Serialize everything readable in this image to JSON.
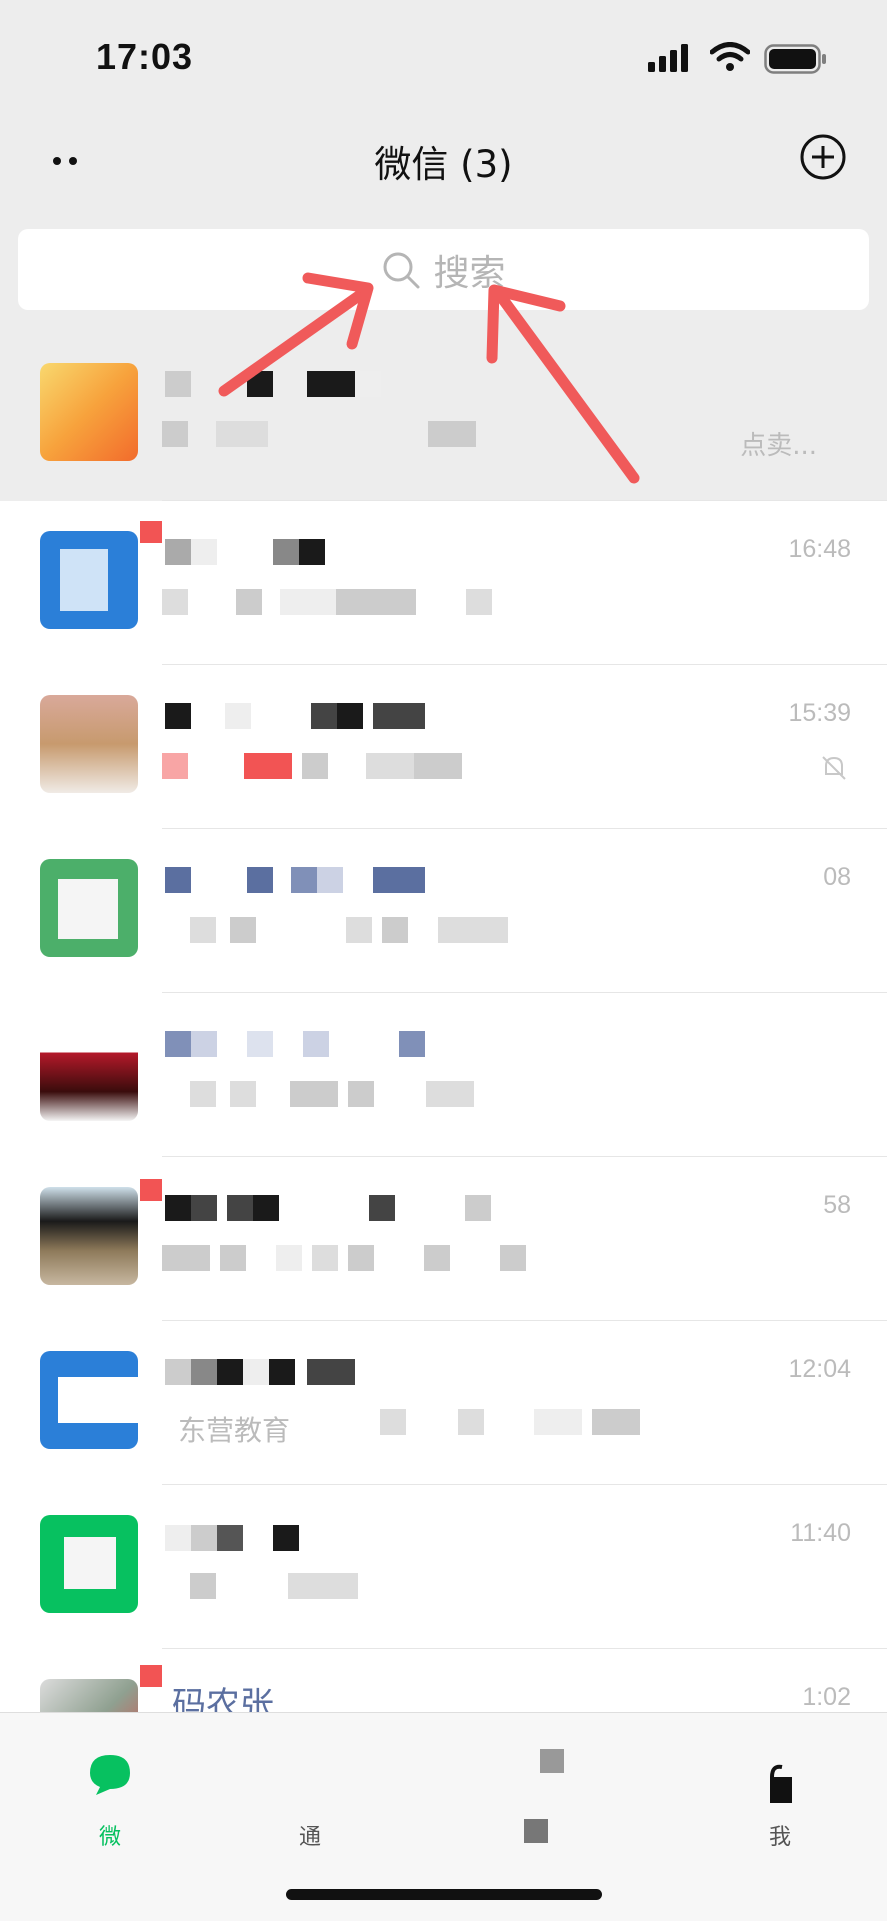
{
  "status_bar": {
    "time": "17:03"
  },
  "header": {
    "title": "微信 (3)"
  },
  "search": {
    "placeholder": "搜索"
  },
  "chats": [
    {
      "time": "",
      "snippet": "点卖..."
    },
    {
      "time": "16:48",
      "snippet": ""
    },
    {
      "time": "15:39",
      "snippet": ""
    },
    {
      "time": "08",
      "snippet": ""
    },
    {
      "time": "",
      "snippet": ""
    },
    {
      "time": "58",
      "snippet": ""
    },
    {
      "time": "12:04",
      "snippet": "东营教育"
    },
    {
      "time": "11:40",
      "snippet": ""
    },
    {
      "time": "1:02",
      "name": "码农张",
      "snippet": ""
    }
  ],
  "tabs": [
    {
      "label": "微"
    },
    {
      "label": "通"
    },
    {
      "label": ""
    },
    {
      "label": "我"
    }
  ],
  "colors": {
    "accent": "#07c160",
    "annotation_arrow": "#f05a5a",
    "background": "#ededed"
  },
  "icons": [
    "more-dots-icon",
    "add-circle-icon",
    "search-icon",
    "mute-bell-icon",
    "chat-icon",
    "signal-icon",
    "wifi-icon",
    "battery-icon"
  ]
}
